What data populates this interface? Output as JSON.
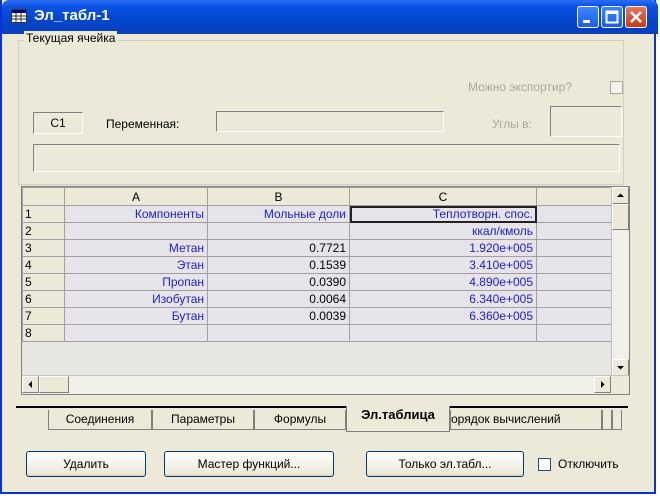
{
  "window": {
    "title": "Эл_табл-1"
  },
  "current_cell": {
    "legend": "Текущая ячейка",
    "export_label": "Можно экспортир?",
    "cell_name": "C1",
    "variable_label": "Переменная:",
    "variable_value": "",
    "angles_label": "Углы в:",
    "angles_value": "",
    "formula_value": ""
  },
  "grid": {
    "columns": [
      "",
      "A",
      "B",
      "C",
      ""
    ],
    "rows": [
      {
        "n": "1",
        "a": "Компоненты",
        "b": "Мольные доли",
        "c": "Теплотворн. спос.",
        "d": ""
      },
      {
        "n": "2",
        "a": "",
        "b": "",
        "c": "ккал/кмоль",
        "d": ""
      },
      {
        "n": "3",
        "a": "Метан",
        "b": "0.7721",
        "c": "1.920e+005",
        "d": ""
      },
      {
        "n": "4",
        "a": "Этан",
        "b": "0.1539",
        "c": "3.410e+005",
        "d": ""
      },
      {
        "n": "5",
        "a": "Пропан",
        "b": "0.0390",
        "c": "4.890e+005",
        "d": ""
      },
      {
        "n": "6",
        "a": "Изобутан",
        "b": "0.0064",
        "c": "6.340e+005",
        "d": ""
      },
      {
        "n": "7",
        "a": "Бутан",
        "b": "0.0039",
        "c": "6.360e+005",
        "d": ""
      },
      {
        "n": "8",
        "a": "",
        "b": "",
        "c": "",
        "d": ""
      }
    ],
    "selected_cell": "C1"
  },
  "tabs": [
    {
      "label": "Соединения",
      "active": false
    },
    {
      "label": "Параметры",
      "active": false
    },
    {
      "label": "Формулы",
      "active": false
    },
    {
      "label": "Эл.таблица",
      "active": true
    },
    {
      "label": "орядок вычислений",
      "active": false
    }
  ],
  "buttons": {
    "delete": "Удалить",
    "function_wizard": "Мастер функций...",
    "table_only": "Только эл.табл...",
    "disable_label": "Отключить",
    "disable_checked": false
  },
  "colors": {
    "title_bar": "#0a54e3",
    "cell_text_blue": "#2020d0",
    "face": "#ece9d8"
  }
}
